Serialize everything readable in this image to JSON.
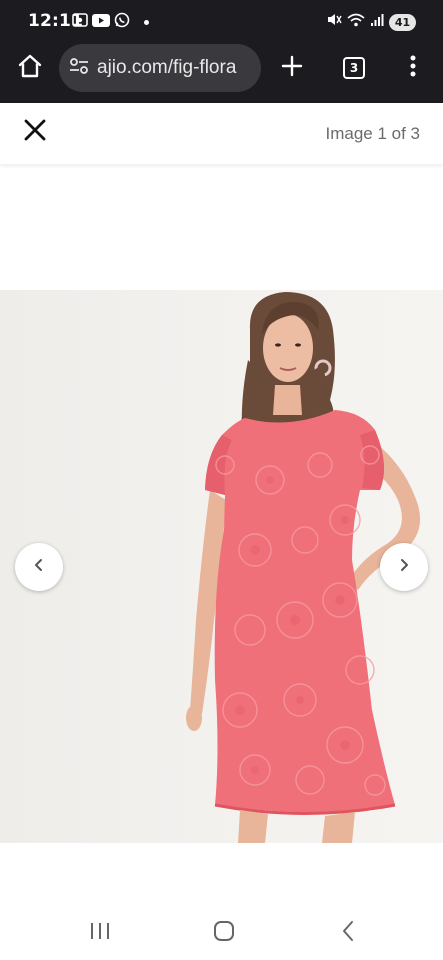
{
  "status_bar": {
    "time": "12:11",
    "battery": "41"
  },
  "browser": {
    "url": "ajio.com/fig-flora",
    "tab_count": "3"
  },
  "gallery": {
    "counter": "Image 1 of 3"
  },
  "product_image": {
    "subject": "woman in pink floral lace short-sleeve shift dress",
    "dress_color": "#f0707a",
    "background_color": "#f1efec"
  },
  "icons": {
    "home": "home-icon",
    "site_info": "tune-icon",
    "new_tab": "plus-icon",
    "menu": "more-vert-icon",
    "close": "close-icon",
    "prev": "chevron-left-icon",
    "next": "chevron-right-icon"
  }
}
